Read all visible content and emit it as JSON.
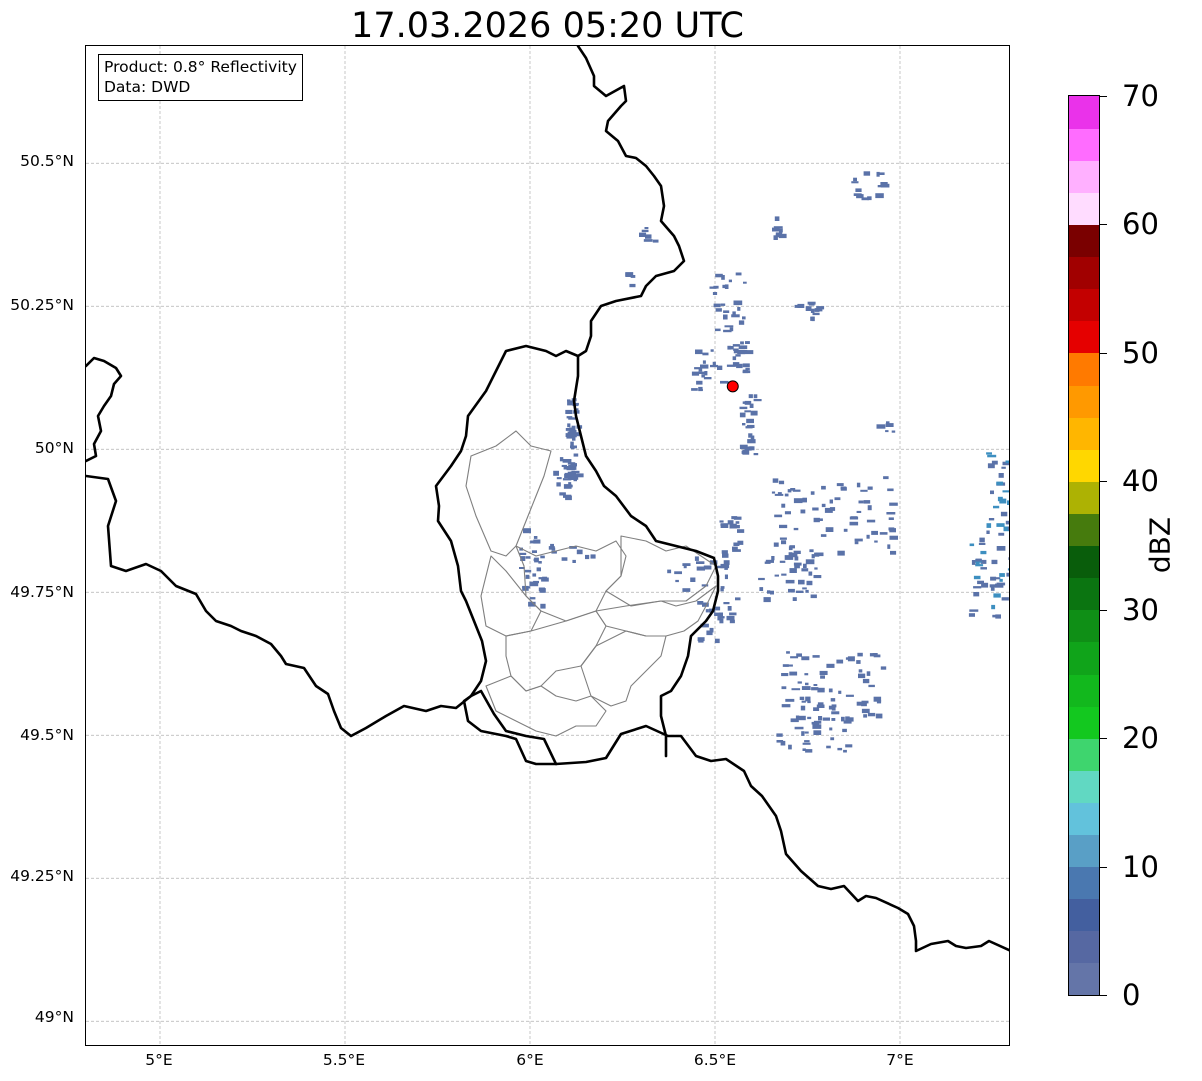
{
  "title": "17.03.2026 05:20 UTC",
  "info_box": {
    "product": "Product: 0.8° Reflectivity",
    "data": "Data: DWD"
  },
  "latitude_labels": [
    "50.5°N",
    "50.25°N",
    "50°N",
    "49.75°N",
    "49.5°N",
    "49.25°N",
    "49°N"
  ],
  "longitude_labels": [
    "5°E",
    "5.5°E",
    "6°E",
    "6.5°E",
    "7°E"
  ],
  "colorbar": {
    "label": "dBZ",
    "tick_labels": [
      "0",
      "10",
      "20",
      "30",
      "40",
      "50",
      "60",
      "70"
    ],
    "step_dbz": 2.5,
    "colors": [
      "#6475a8",
      "#5668a2",
      "#435f9f",
      "#4a78b0",
      "#599fc6",
      "#62c2dc",
      "#61d8c2",
      "#3ed56e",
      "#13c81f",
      "#12b81d",
      "#10a41a",
      "#0f8f16",
      "#0b7511",
      "#095d0b",
      "#467b0d",
      "#adb203",
      "#ffd700",
      "#ffb600",
      "#ff9900",
      "#ff7a00",
      "#e50000",
      "#c30000",
      "#a10000",
      "#7a0000",
      "#ffdcff",
      "#ffb0ff",
      "#ff6cff",
      "#ea32ea"
    ]
  },
  "map": {
    "extent": {
      "lon": [
        4.8,
        7.3
      ],
      "lat": [
        48.955,
        50.705
      ]
    },
    "radar_site": {
      "lon": 6.548,
      "lat": 50.11,
      "color": "#ff0000"
    },
    "echo_color": "#5a72a8",
    "echo_color_strong": "#3d8fc0",
    "border_color": "#000000",
    "district_color": "#7f7f7f",
    "grid_color": "#b0b0b0"
  }
}
